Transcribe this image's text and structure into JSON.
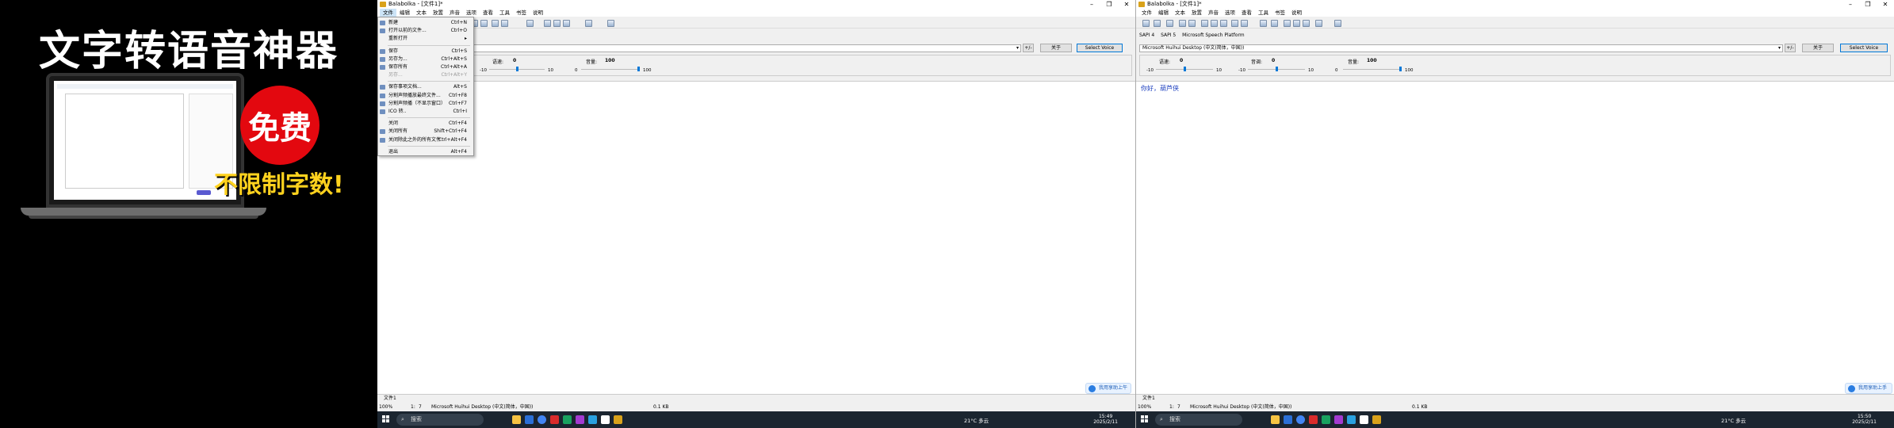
{
  "promo": {
    "title": "文字转语音神器",
    "badge": "免费",
    "subtitle": "不限制字数!"
  },
  "left_window": {
    "title": "Balabolka - [文件1]*",
    "menu": [
      "文件",
      "编辑",
      "文本",
      "放置",
      "声音",
      "选项",
      "查看",
      "工具",
      "书签",
      "说明"
    ],
    "voice_select": "",
    "buttons": {
      "about": "关于",
      "select_voice": "Select Voice",
      "plusminus": "+/-"
    },
    "sliders": [
      {
        "label": "语速:",
        "value": "0",
        "min": "-10",
        "max": "10",
        "level": 0.5
      },
      {
        "label": "音量:",
        "value": "100",
        "min": "0",
        "max": "100",
        "level": 1.0
      }
    ],
    "doc_tab": "文件1",
    "status": {
      "zoom": "100%",
      "line": "1:",
      "col": "7",
      "voice": "Microsoft Huihui Desktop (中文(简体，中国))",
      "size": "0.1 KB"
    },
    "helper": "我用享助上午",
    "clock": {
      "time": "15:49",
      "date": "2025/2/11"
    },
    "taskbar_search": "搜索"
  },
  "file_menu": [
    {
      "label": "新建",
      "shortcut": "Ctrl+N",
      "icon": "new-file-icon"
    },
    {
      "label": "打开以前的文件...",
      "shortcut": "Ctrl+O",
      "icon": "open-icon"
    },
    {
      "label": "重新打开",
      "shortcut": "",
      "submenu": true,
      "icon": ""
    },
    {
      "sep": true
    },
    {
      "label": "保存",
      "shortcut": "Ctrl+S",
      "icon": "save-icon"
    },
    {
      "label": "另存为...",
      "shortcut": "Ctrl+Alt+S",
      "icon": "save-as-icon"
    },
    {
      "label": "保存所有",
      "shortcut": "Ctrl+Alt+A",
      "icon": "save-all-icon"
    },
    {
      "label": "另存...",
      "shortcut": "Ctrl+Alt+Y",
      "icon": "",
      "disabled": true
    },
    {
      "sep": true
    },
    {
      "label": "保存事项文档...",
      "shortcut": "Alt+S",
      "icon": "doc-icon"
    },
    {
      "label": "分割声频播放最终文件...",
      "shortcut": "Ctrl+F8",
      "icon": "split-icon"
    },
    {
      "label": "分割声频播（不显示窗口）",
      "shortcut": "Ctrl+F7",
      "icon": "split-quiet-icon"
    },
    {
      "label": "ICO 转..",
      "shortcut": "Ctrl+I",
      "icon": "ico-icon"
    },
    {
      "sep": true
    },
    {
      "label": "关闭",
      "shortcut": "Ctrl+F4",
      "icon": ""
    },
    {
      "label": "关闭所有",
      "shortcut": "Shift+Ctrl+F4",
      "icon": "close-all-icon"
    },
    {
      "label": "关闭除此之外的所有文件",
      "shortcut": "Ctrl+Alt+F4",
      "icon": "close-others-icon"
    },
    {
      "sep": true
    },
    {
      "label": "退出",
      "shortcut": "Alt+F4",
      "icon": ""
    }
  ],
  "right_window": {
    "title": "Balabolka - [文件1]*",
    "menu": [
      "文件",
      "编辑",
      "文本",
      "放置",
      "声音",
      "选项",
      "查看",
      "工具",
      "书签",
      "说明"
    ],
    "tabs": [
      "SAPI 4",
      "SAPI 5",
      "Microsoft Speech Platform"
    ],
    "voice_select": "Microsoft Huihui Desktop (中文(简体，中国))",
    "buttons": {
      "about": "关于",
      "select_voice": "Select Voice",
      "plusminus": "+/-"
    },
    "sliders": [
      {
        "label": "语速:",
        "value": "0",
        "min": "-10",
        "max": "10",
        "level": 0.5
      },
      {
        "label": "音调:",
        "value": "0",
        "min": "-10",
        "max": "10",
        "level": 0.5
      },
      {
        "label": "音量:",
        "value": "100",
        "min": "0",
        "max": "100",
        "level": 1.0
      }
    ],
    "editor_text": "你好，葫芦侠",
    "doc_tab": "文件1",
    "status": {
      "zoom": "100%",
      "line": "1:",
      "col": "7",
      "voice": "Microsoft Huihui Desktop (中文(简体，中国))",
      "size": "0.1 KB"
    },
    "helper": "我用享助上手",
    "weather": "21°C 多云",
    "clock": {
      "time": "15:50",
      "date": "2025/2/11"
    },
    "taskbar_search": "搜索"
  },
  "left_weather": "21°C 多云",
  "colors": {
    "accent": "#0078d7",
    "badge_red": "#e3080f",
    "promo_yellow": "#ffd21e",
    "editor_text": "#1c3fbf",
    "taskbar": "#1b2530"
  }
}
